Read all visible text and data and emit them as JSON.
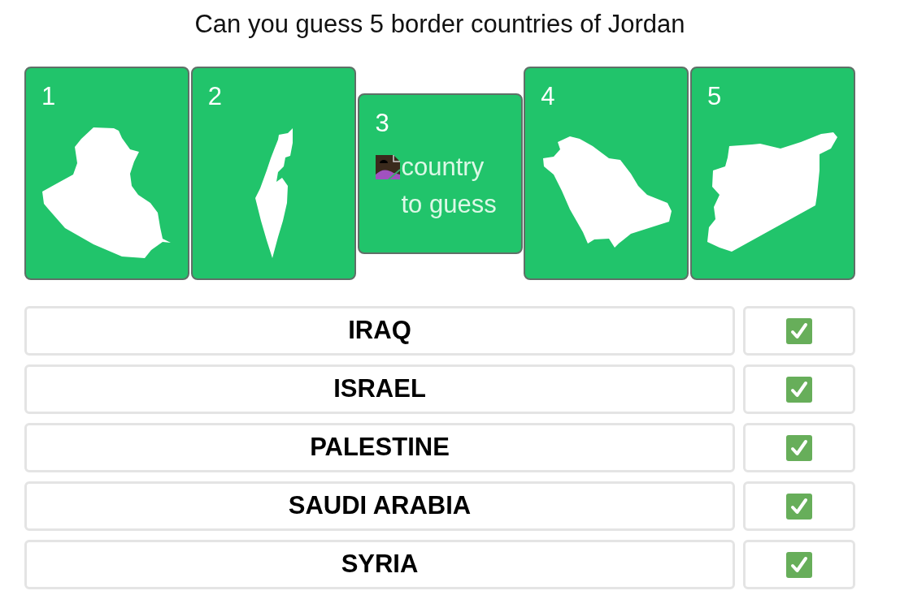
{
  "title": "Can you guess 5 border countries of Jordan",
  "cards": [
    {
      "number": "1",
      "kind": "map"
    },
    {
      "number": "2",
      "kind": "map"
    },
    {
      "number": "3",
      "kind": "placeholder",
      "label": "country to guess"
    },
    {
      "number": "4",
      "kind": "map"
    },
    {
      "number": "5",
      "kind": "map"
    }
  ],
  "answers": [
    {
      "text": "IRAQ",
      "checked": true
    },
    {
      "text": "ISRAEL",
      "checked": true
    },
    {
      "text": "PALESTINE",
      "checked": true
    },
    {
      "text": "SAUDI ARABIA",
      "checked": true
    },
    {
      "text": "SYRIA",
      "checked": true
    }
  ]
}
